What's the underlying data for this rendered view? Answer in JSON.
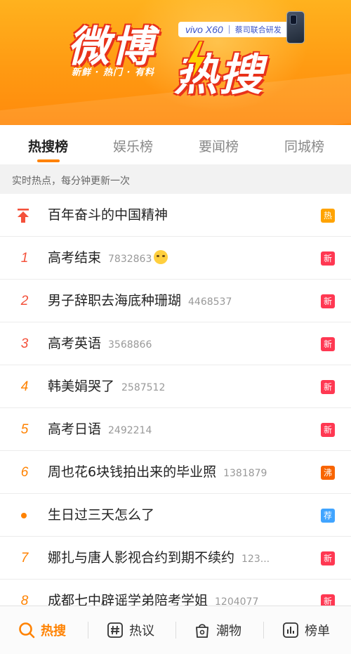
{
  "banner": {
    "title_part1": "微博",
    "title_part2": "热搜",
    "tagline": "新鲜 · 热门 · 有料",
    "sponsor_brand": "vivo X60",
    "sponsor_tag": "蔡司联合研发"
  },
  "tabs": [
    {
      "label": "热搜榜",
      "active": true
    },
    {
      "label": "娱乐榜",
      "active": false
    },
    {
      "label": "要闻榜",
      "active": false
    },
    {
      "label": "同城榜",
      "active": false
    }
  ],
  "subtitle": "实时热点，每分钟更新一次",
  "list": [
    {
      "rank": "",
      "rank_icon": "pin-top-icon",
      "title": "百年奋斗的中国精神",
      "count": "",
      "badge": "热",
      "badge_type": "hot"
    },
    {
      "rank": "1",
      "title": "高考结束",
      "count": "7832863",
      "emoji": "crying-face-emoji",
      "badge": "新",
      "badge_type": "new"
    },
    {
      "rank": "2",
      "title": "男子辞职去海底种珊瑚",
      "count": "4468537",
      "badge": "新",
      "badge_type": "new"
    },
    {
      "rank": "3",
      "title": "高考英语",
      "count": "3568866",
      "badge": "新",
      "badge_type": "new"
    },
    {
      "rank": "4",
      "title": "韩美娟哭了",
      "count": "2587512",
      "badge": "新",
      "badge_type": "new"
    },
    {
      "rank": "5",
      "title": "高考日语",
      "count": "2492214",
      "badge": "新",
      "badge_type": "new"
    },
    {
      "rank": "6",
      "title": "周也花6块钱拍出来的毕业照",
      "count": "1381879",
      "badge": "沸",
      "badge_type": "boil"
    },
    {
      "rank": "",
      "rank_icon": "dot-icon",
      "title": "生日过三天怎么了",
      "count": "",
      "badge": "荐",
      "badge_type": "recommend"
    },
    {
      "rank": "7",
      "title": "娜扎与唐人影视合约到期不续约",
      "count": "123...",
      "badge": "新",
      "badge_type": "new"
    },
    {
      "rank": "8",
      "title": "成都七中辟谣学弟陪考学姐",
      "count": "1204077",
      "badge": "新",
      "badge_type": "new"
    }
  ],
  "bottom_nav": [
    {
      "label": "热搜",
      "icon": "search-icon",
      "active": true
    },
    {
      "label": "热议",
      "icon": "hashtag-icon",
      "active": false
    },
    {
      "label": "潮物",
      "icon": "bag-icon",
      "active": false
    },
    {
      "label": "榜单",
      "icon": "chart-icon",
      "active": false
    }
  ],
  "colors": {
    "accent": "#ff8200",
    "rank_top3": "#f4513b",
    "badge_hot": "#ffa300",
    "badge_new": "#ff3852",
    "badge_boil": "#f86400",
    "badge_recommend": "#40a4ff"
  }
}
